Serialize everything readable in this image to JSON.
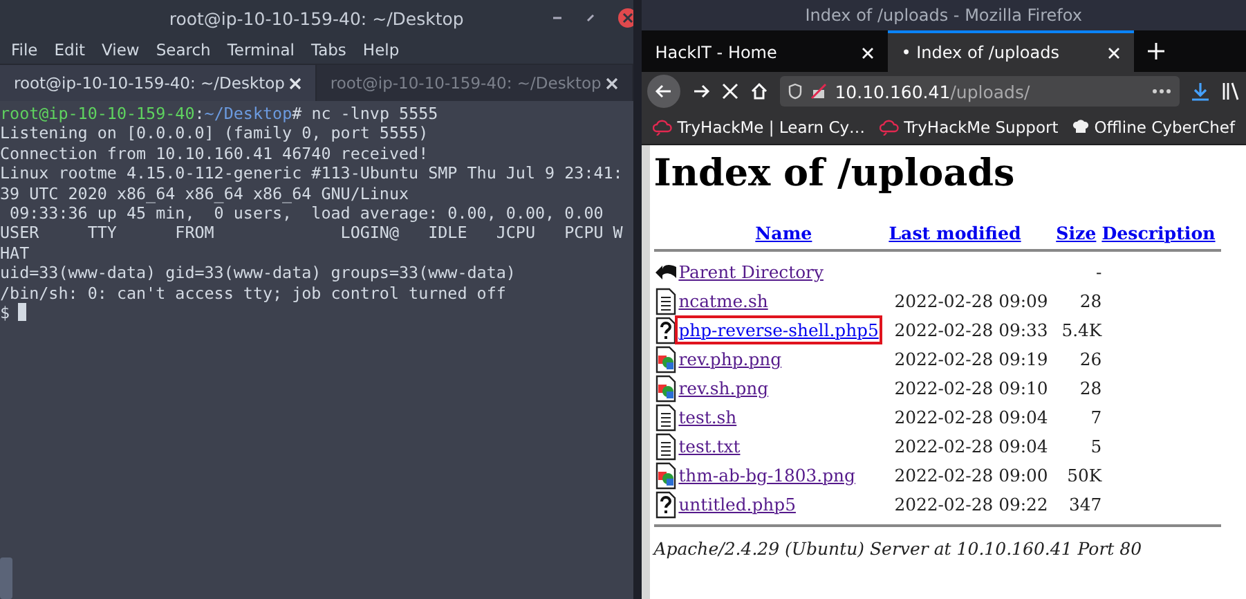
{
  "terminal": {
    "title": "root@ip-10-10-159-40: ~/Desktop",
    "menu": [
      "File",
      "Edit",
      "View",
      "Search",
      "Terminal",
      "Tabs",
      "Help"
    ],
    "tabs": [
      {
        "label": "root@ip-10-10-159-40: ~/Desktop",
        "selected": true
      },
      {
        "label": "root@ip-10-10-159-40: ~/Desktop",
        "selected": false
      }
    ],
    "prompt": {
      "user_host": "root@ip-10-10-159-40",
      "separator": ":",
      "path": "~/Desktop",
      "command": "# nc -lnvp 5555"
    },
    "output": [
      "Listening on [0.0.0.0] (family 0, port 5555)",
      "Connection from 10.10.160.41 46740 received!",
      "Linux rootme 4.15.0-112-generic #113-Ubuntu SMP Thu Jul 9 23:41:",
      "39 UTC 2020 x86_64 x86_64 x86_64 GNU/Linux",
      " 09:33:36 up 45 min,  0 users,  load average: 0.00, 0.00, 0.00",
      "USER     TTY      FROM             LOGIN@   IDLE   JCPU   PCPU W",
      "HAT",
      "uid=33(www-data) gid=33(www-data) groups=33(www-data)",
      "/bin/sh: 0: can't access tty; job control turned off"
    ],
    "input_prompt": "$"
  },
  "browser": {
    "title": "Index of /uploads - Mozilla Firefox",
    "tabs": [
      {
        "label": "HackIT - Home",
        "selected": false
      },
      {
        "label": "Index of /uploads",
        "selected": true,
        "indicator": "•"
      }
    ],
    "url": {
      "host": "10.10.160.41",
      "path": "/uploads/"
    },
    "bookmarks": [
      {
        "label": "TryHackMe | Learn Cy…",
        "kind": "cloud"
      },
      {
        "label": "TryHackMe Support",
        "kind": "cloud"
      },
      {
        "label": "Offline CyberChef",
        "kind": "chef"
      }
    ],
    "page": {
      "heading": "Index of /uploads",
      "columns": [
        "Name",
        "Last modified",
        "Size",
        "Description"
      ],
      "rows": [
        {
          "kind": "back",
          "name": "Parent Directory",
          "modified": "",
          "size": "-",
          "highlighted": false
        },
        {
          "kind": "text",
          "name": "ncatme.sh",
          "modified": "2022-02-28 09:09",
          "size": "28",
          "highlighted": false
        },
        {
          "kind": "unknown",
          "name": "php-reverse-shell.php5",
          "modified": "2022-02-28 09:33",
          "size": "5.4K",
          "highlighted": true
        },
        {
          "kind": "image",
          "name": "rev.php.png",
          "modified": "2022-02-28 09:19",
          "size": "26",
          "highlighted": false
        },
        {
          "kind": "image",
          "name": "rev.sh.png",
          "modified": "2022-02-28 09:10",
          "size": "28",
          "highlighted": false
        },
        {
          "kind": "text",
          "name": "test.sh",
          "modified": "2022-02-28 09:04",
          "size": "7",
          "highlighted": false
        },
        {
          "kind": "text",
          "name": "test.txt",
          "modified": "2022-02-28 09:04",
          "size": "5",
          "highlighted": false
        },
        {
          "kind": "image",
          "name": "thm-ab-bg-1803.png",
          "modified": "2022-02-28 09:00",
          "size": "50K",
          "highlighted": false
        },
        {
          "kind": "unknown",
          "name": "untitled.php5",
          "modified": "2022-02-28 09:22",
          "size": "347",
          "highlighted": false
        }
      ],
      "footer": "Apache/2.4.29 (Ubuntu) Server at 10.10.160.41 Port 80"
    }
  }
}
